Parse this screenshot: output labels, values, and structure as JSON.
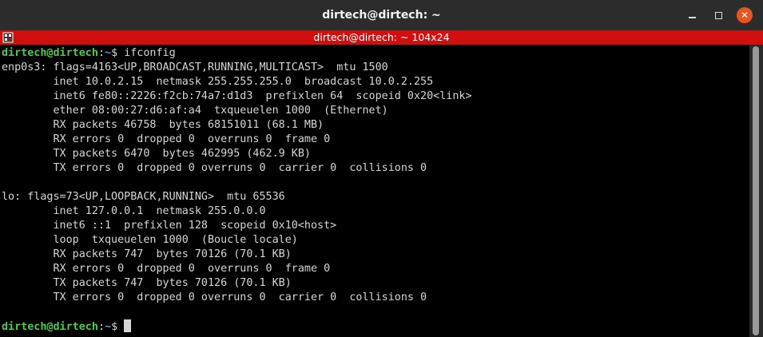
{
  "window": {
    "title": "dirtech@dirtech: ~",
    "tab_title": "dirtech@dirtech: ~ 104x24",
    "close_glyph": "✕"
  },
  "colors": {
    "tab_bar": "#d10f0f",
    "prompt_user": "#4ec94e",
    "prompt_path": "#6c8fd9",
    "close_button": "#e95420"
  },
  "prompt": {
    "user_host": "dirtech@dirtech",
    "separator": ":",
    "path": "~",
    "symbol": "$"
  },
  "command": "ifconfig",
  "output": [
    "enp0s3: flags=4163<UP,BROADCAST,RUNNING,MULTICAST>  mtu 1500",
    "        inet 10.0.2.15  netmask 255.255.255.0  broadcast 10.0.2.255",
    "        inet6 fe80::2226:f2cb:74a7:d1d3  prefixlen 64  scopeid 0x20<link>",
    "        ether 08:00:27:d6:af:a4  txqueuelen 1000  (Ethernet)",
    "        RX packets 46758  bytes 68151011 (68.1 MB)",
    "        RX errors 0  dropped 0  overruns 0  frame 0",
    "        TX packets 6470  bytes 462995 (462.9 KB)",
    "        TX errors 0  dropped 0 overruns 0  carrier 0  collisions 0",
    "",
    "lo: flags=73<UP,LOOPBACK,RUNNING>  mtu 65536",
    "        inet 127.0.0.1  netmask 255.0.0.0",
    "        inet6 ::1  prefixlen 128  scopeid 0x10<host>",
    "        loop  txqueuelen 1000  (Boucle locale)",
    "        RX packets 747  bytes 70126 (70.1 KB)",
    "        RX errors 0  dropped 0  overruns 0  frame 0",
    "        TX packets 747  bytes 70126 (70.1 KB)",
    "        TX errors 0  dropped 0 overruns 0  carrier 0  collisions 0",
    ""
  ],
  "icons": {
    "minimize": "minimize-icon",
    "maximize": "maximize-icon",
    "close": "close-icon",
    "tab": "terminal-tab-icon"
  }
}
